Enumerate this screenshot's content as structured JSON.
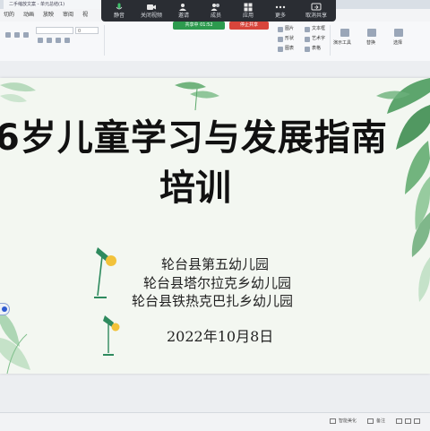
{
  "window": {
    "file_tab": "二手缩放文案 - 单元总结(1)"
  },
  "menu": {
    "items": [
      "切的",
      "动画",
      "放映",
      "审阅",
      "视"
    ]
  },
  "ribbon": {
    "font_size_value": "0",
    "right_buttons": [
      "图片",
      "文本框",
      "艺术字",
      "形状",
      "图表",
      "表格"
    ],
    "right_group_labels": [
      "演示工具",
      "替换",
      "选择"
    ]
  },
  "meeting": {
    "buttons": [
      {
        "label": "静音",
        "icon": "microphone-icon"
      },
      {
        "label": "关闭视频",
        "icon": "camera-icon"
      },
      {
        "label": "邀请",
        "icon": "invite-icon"
      },
      {
        "label": "成员",
        "icon": "members-icon"
      },
      {
        "label": "应用",
        "icon": "apps-icon"
      },
      {
        "label": "更多",
        "icon": "more-icon"
      },
      {
        "label": "取消共享",
        "icon": "share-icon"
      }
    ],
    "sharing_status": "共享中 01:52",
    "stop_share": "停止共享"
  },
  "slide": {
    "title_line1": "6岁儿童学习与发展指南",
    "title_line2": "培训",
    "orgs": [
      "轮台县第五幼儿园",
      "轮台县塔尔拉克乡幼儿园",
      "轮台县铁热克巴扎乡幼儿园"
    ],
    "date": "2022年10月8日"
  },
  "statusbar": {
    "left": "",
    "notes_label": "备注",
    "smart_label": "智能美化"
  },
  "colors": {
    "leaf_green": "#5aa86a",
    "lamp_green": "#2e8a5e",
    "lamp_yellow": "#f2c23a",
    "accent_blue": "#2f5bd0"
  }
}
